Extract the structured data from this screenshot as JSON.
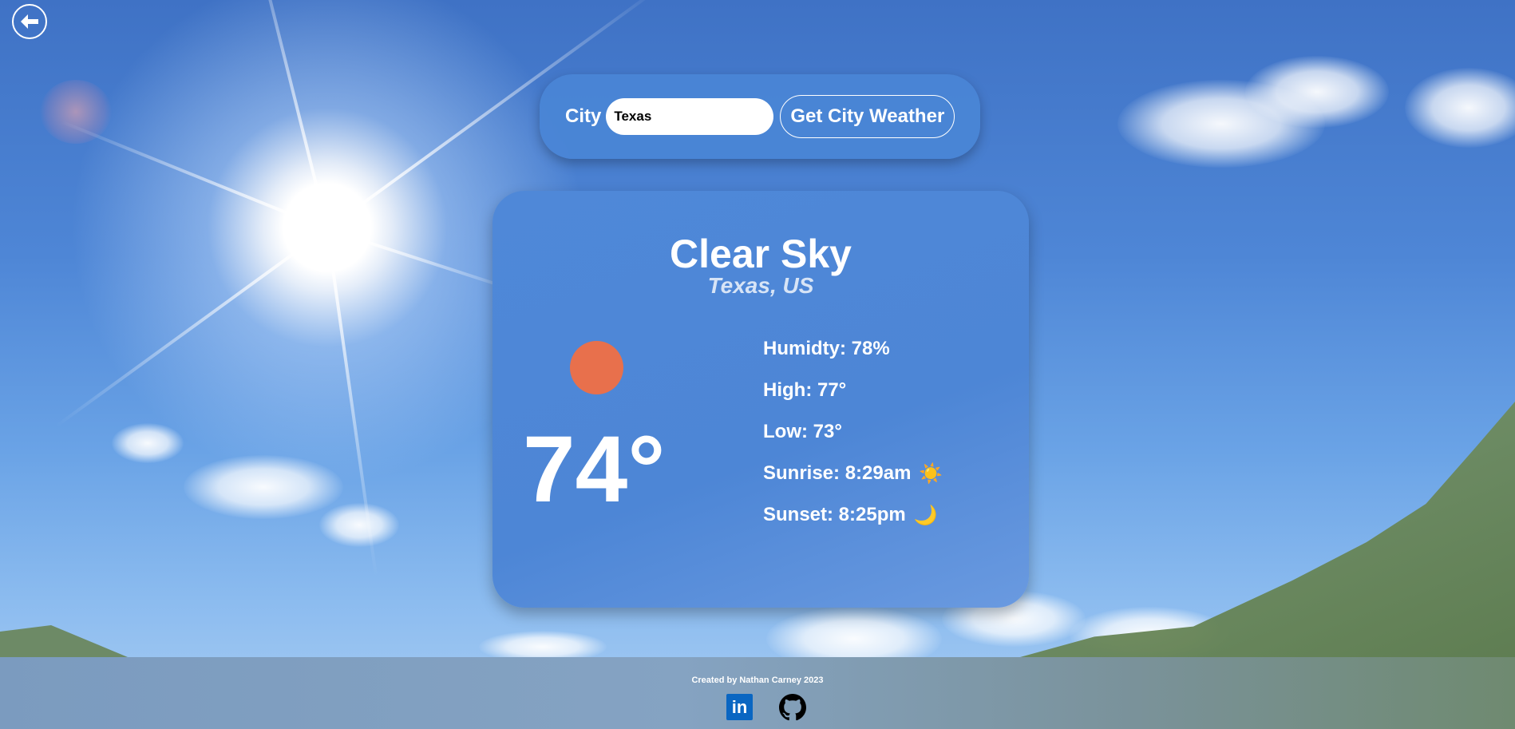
{
  "search": {
    "label": "City",
    "value": "Texas"
  },
  "buttons": {
    "get_weather": "Get City Weather",
    "back_icon": "arrow-left-icon"
  },
  "weather": {
    "condition": "Clear Sky",
    "location": "Texas, US",
    "temperature": "74°",
    "icon": "sun-icon",
    "stats": {
      "humidity": "Humidty: 78%",
      "high": "High: 77°",
      "low": "Low: 73°",
      "sunrise": "Sunrise: 8:29am",
      "sunset": "Sunset: 8:25pm"
    },
    "stat_icons": {
      "sunrise": "☀️",
      "sunset": "🌙"
    }
  },
  "footer": {
    "credit": "Created by Nathan Carney 2023",
    "links": [
      "linkedin-icon",
      "github-icon"
    ]
  },
  "colors": {
    "card": "#4f88d8",
    "sun_dot": "#e8704c",
    "linkedin": "#0a66c2"
  }
}
